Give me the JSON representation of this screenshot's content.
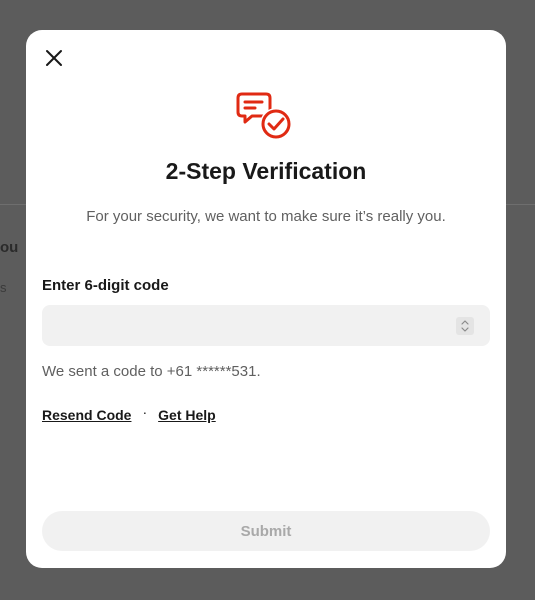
{
  "background": {
    "partial_text_1": "ou",
    "partial_text_2": "s"
  },
  "dialog": {
    "close_icon": "close-icon",
    "header_icon": "chat-check-icon",
    "title": "2-Step Verification",
    "subtitle": "For your security, we want to make sure it’s really you.",
    "code_field": {
      "label": "Enter 6-digit code",
      "value": "",
      "placeholder": ""
    },
    "sent_message": "We sent a code to +61 ******531.",
    "links": {
      "resend": "Resend Code",
      "separator": "·",
      "help": "Get Help"
    },
    "submit_label": "Submit"
  },
  "colors": {
    "accent": "#e02a13",
    "title": "#191919",
    "muted": "#606060",
    "input_bg": "#f1f1f1",
    "submit_disabled_text": "#a9a9a9",
    "backdrop": "#5c5c5c"
  }
}
